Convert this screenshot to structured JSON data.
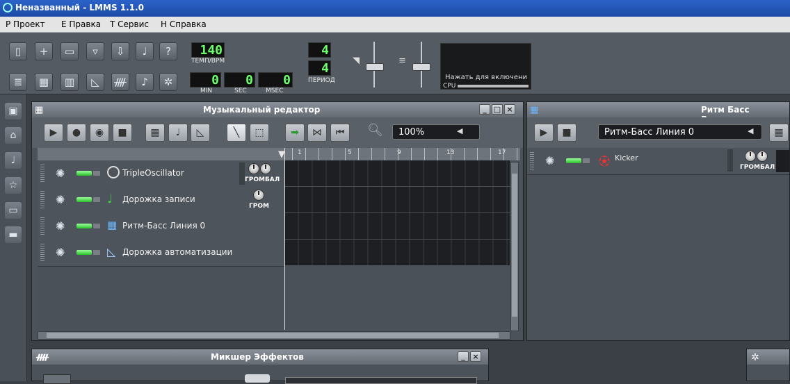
{
  "window": {
    "title": "Неназванный - LMMS 1.1.0"
  },
  "menu": [
    {
      "label": "Р Проект"
    },
    {
      "label": "Е Правка"
    },
    {
      "label": "Т Сервис"
    },
    {
      "label": "Н Справка"
    }
  ],
  "toolbar": {
    "tempo_value": "140",
    "tempo_label": "ТЕМП/BPM",
    "time_min": "0",
    "time_sec": "0",
    "time_msec": "0",
    "min_label": "MIN",
    "sec_label": "SEC",
    "msec_label": "MSEC",
    "timesig_num": "4",
    "timesig_den": "4",
    "period_label": "ПЕРИОД",
    "cpu_hint": "Нажать для включени",
    "cpu_label": "CPU"
  },
  "song_editor": {
    "title": "Музыкальный редактор",
    "zoom": "100%",
    "ruler": [
      "1",
      "5",
      "9",
      "13",
      "17"
    ],
    "tracks": [
      {
        "name": "TripleOscillator",
        "knob_label": "ГРОМБАЛ"
      },
      {
        "name": "Дорожка записи",
        "knob_label": "ГРОМ"
      },
      {
        "name": "Ритм-Басс Линия 0"
      },
      {
        "name": "Дорожка автоматизации"
      }
    ]
  },
  "bb_editor": {
    "title": "Ритм Басс Редакто",
    "selector": "Ритм-Басс Линия 0",
    "track_name": "Kicker",
    "knob_label": "ГРОМБАЛ"
  },
  "fx_mixer": {
    "title": "Микшер Эффектов"
  },
  "colors": {
    "title_blue": "#2c63c9",
    "led_green": "#6cff6c",
    "panel": "#4c5259"
  }
}
